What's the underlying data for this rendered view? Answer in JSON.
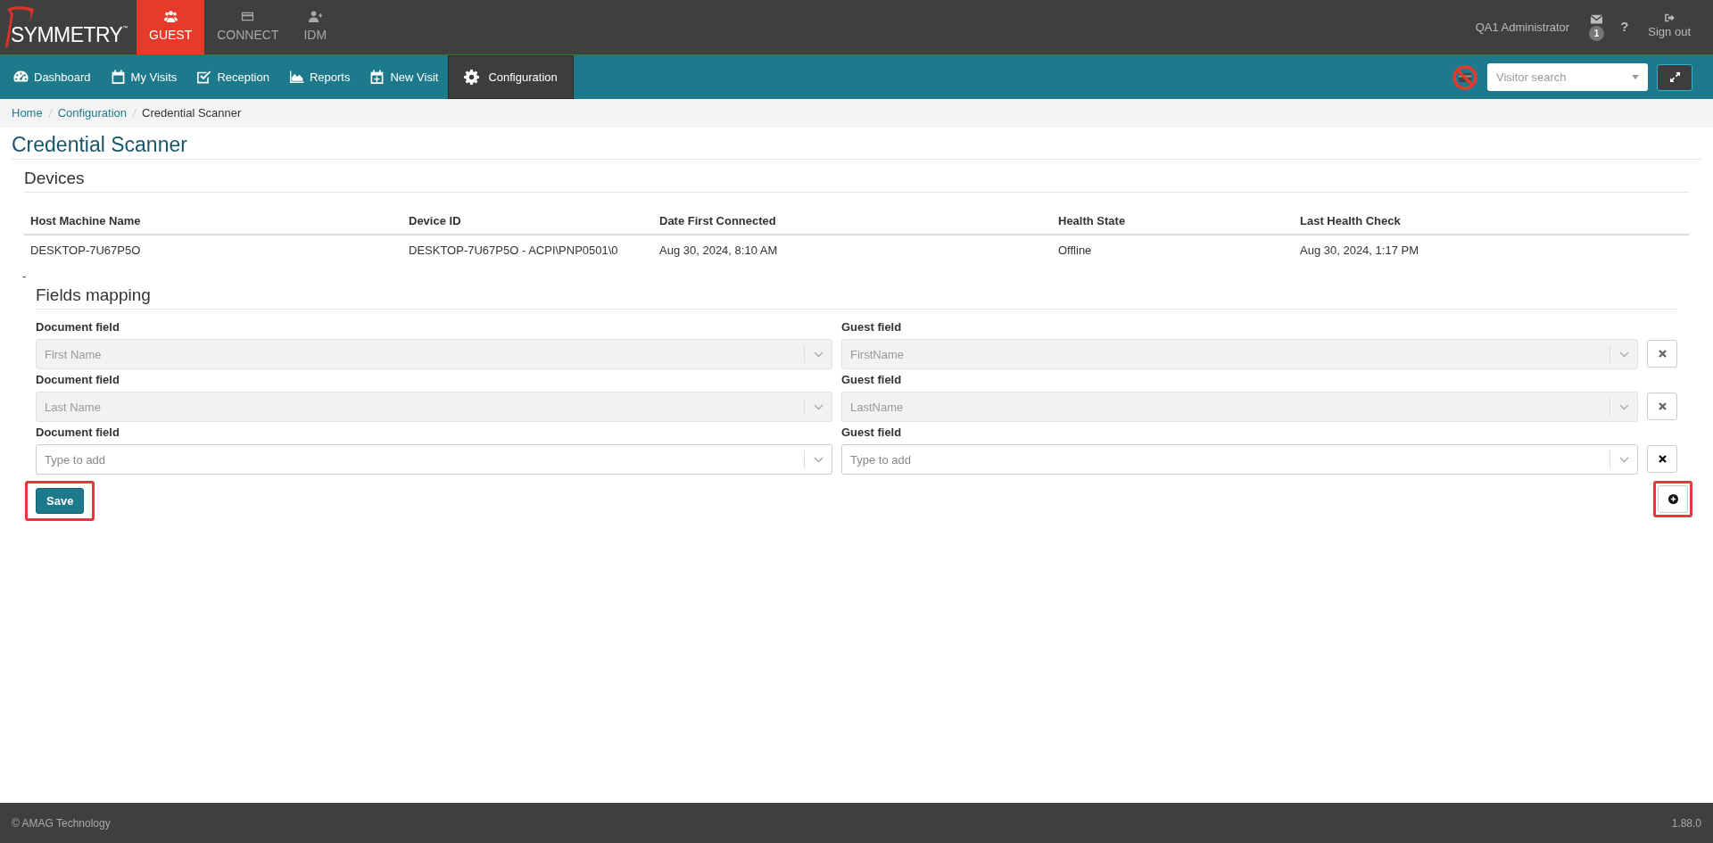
{
  "brand": {
    "name": "SYMMETRY",
    "mark": "™"
  },
  "apps": [
    {
      "label": "GUEST",
      "selected": true
    },
    {
      "label": "CONNECT",
      "selected": false
    },
    {
      "label": "IDM",
      "selected": false
    }
  ],
  "user": {
    "name": "QA1 Administrator",
    "messages_badge": "1",
    "help": "?",
    "sign_out": "Sign out"
  },
  "nav": [
    {
      "label": "Dashboard",
      "selected": false
    },
    {
      "label": "My Visits",
      "selected": false
    },
    {
      "label": "Reception",
      "selected": false
    },
    {
      "label": "Reports",
      "selected": false
    },
    {
      "label": "New Visit",
      "selected": false
    },
    {
      "label": "Configuration",
      "selected": true
    }
  ],
  "visitor_search": {
    "placeholder": "Visitor search"
  },
  "breadcrumb": [
    {
      "label": "Home",
      "link": true
    },
    {
      "label": "Configuration",
      "link": true
    },
    {
      "label": "Credential Scanner",
      "link": false
    }
  ],
  "page_title": "Credential Scanner",
  "devices": {
    "title": "Devices",
    "columns": [
      "Host Machine Name",
      "Device ID",
      "Date First Connected",
      "Health State",
      "Last Health Check"
    ],
    "rows": [
      [
        "DESKTOP-7U67P5O",
        "DESKTOP-7U67P5O - ACPI\\PNP0501\\0",
        "Aug 30, 2024, 8:10 AM",
        "Offline",
        "Aug 30, 2024, 1:17 PM"
      ]
    ]
  },
  "separator_mark": "-",
  "fields_mapping": {
    "title": "Fields mapping",
    "rows": [
      {
        "document": {
          "label": "Document field",
          "value": "First Name",
          "disabled": true
        },
        "guest": {
          "label": "Guest field",
          "value": "FirstName",
          "disabled": true
        }
      },
      {
        "document": {
          "label": "Document field",
          "value": "Last Name",
          "disabled": true
        },
        "guest": {
          "label": "Guest field",
          "value": "LastName",
          "disabled": true
        }
      },
      {
        "document": {
          "label": "Document field",
          "placeholder": "Type to add",
          "disabled": false
        },
        "guest": {
          "label": "Guest field",
          "placeholder": "Type to add",
          "disabled": false
        }
      }
    ],
    "save": "Save"
  },
  "footer": {
    "copyright": "© AMAG Technology",
    "version": "1.88.0"
  }
}
